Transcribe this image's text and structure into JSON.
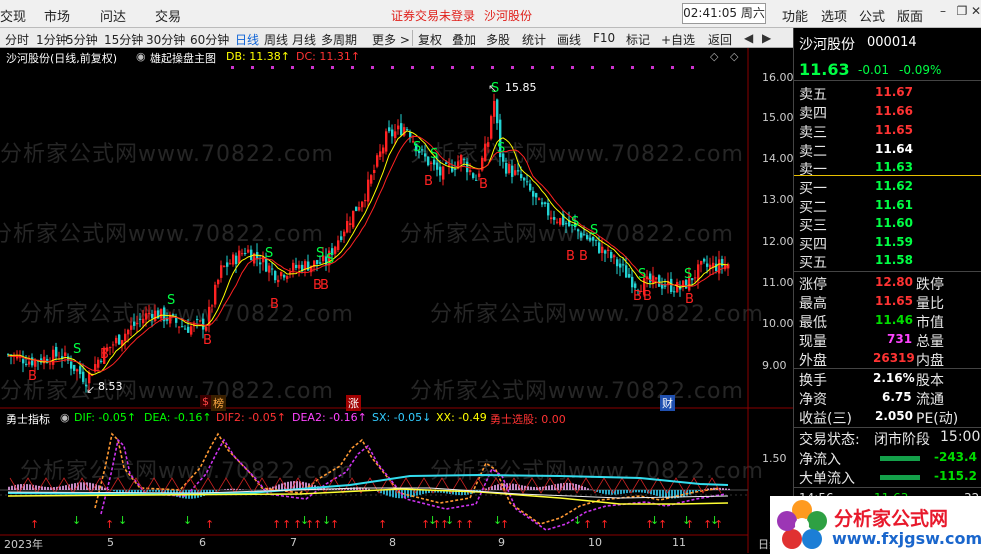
{
  "menubar": {
    "items": [
      "交现",
      "市场",
      "问达",
      "交易"
    ],
    "warning": "证券交易未登录",
    "stock_name": "沙河股份",
    "clock": "02:41:05 周六",
    "right": [
      "功能",
      "选项",
      "公式",
      "版面"
    ]
  },
  "toolbar": {
    "periods": [
      "分时",
      "1分钟",
      "5分钟",
      "15分钟",
      "30分钟",
      "60分钟",
      "日线",
      "周线",
      "月线",
      "多周期",
      "更多 >"
    ],
    "active": "日线",
    "tools": [
      "复权",
      "叠加",
      "多股",
      "统计",
      "画线",
      "F10",
      "标记",
      "+自选",
      "返回"
    ]
  },
  "main_chart": {
    "title": "沙河股份(日线,前复权)",
    "indicator": "雄起操盘主图",
    "db": "DB: 11.38↑",
    "dc": "DC: 11.31↑",
    "hi_label": "15.85",
    "lo_label": "8.53",
    "y_labels": [
      "16.00",
      "15.00",
      "14.00",
      "13.00",
      "12.00",
      "11.00",
      "10.00",
      "9.00"
    ],
    "event_marks": [
      "$",
      "榜",
      "涨",
      "财"
    ]
  },
  "sub_chart": {
    "name": "勇士指标",
    "items": [
      {
        "t": "DIF: -0.05↑",
        "c": "#00ff00"
      },
      {
        "t": "DEA: -0.16↑",
        "c": "#00ff00"
      },
      {
        "t": "DIF2: -0.05↑",
        "c": "#ff3333"
      },
      {
        "t": "DEA2: -0.16↑",
        "c": "#ff44ff"
      },
      {
        "t": "SX: -0.05↓",
        "c": "#33ccff"
      },
      {
        "t": "XX: -0.49",
        "c": "#ffff00"
      },
      {
        "t": "勇士选股: 0.00",
        "c": "#ff3333"
      }
    ],
    "y_label": "1.50"
  },
  "x_axis": [
    "2023年",
    "5",
    "6",
    "7",
    "8",
    "9",
    "10",
    "11",
    "日线"
  ],
  "watermark": "分析家公式网www.70822.com",
  "quote": {
    "name": "沙河股份",
    "code": "000014",
    "price": "11.63",
    "change": "-0.01",
    "pct": "-0.09%",
    "asks": [
      {
        "l": "卖五",
        "p": "11.67"
      },
      {
        "l": "卖四",
        "p": "11.66"
      },
      {
        "l": "卖三",
        "p": "11.65"
      },
      {
        "l": "卖二",
        "p": "11.64"
      },
      {
        "l": "卖一",
        "p": "11.63"
      }
    ],
    "bids": [
      {
        "l": "买一",
        "p": "11.62"
      },
      {
        "l": "买二",
        "p": "11.61"
      },
      {
        "l": "买三",
        "p": "11.60"
      },
      {
        "l": "买四",
        "p": "11.59"
      },
      {
        "l": "买五",
        "p": "11.58"
      }
    ],
    "stats": [
      {
        "l": "涨停",
        "v": "12.80",
        "vc": "#ff3333",
        "r": "跌停"
      },
      {
        "l": "最高",
        "v": "11.65",
        "vc": "#ff3333",
        "r": "量比"
      },
      {
        "l": "最低",
        "v": "11.46",
        "vc": "#00dd00",
        "r": "市值"
      },
      {
        "l": "现量",
        "v": "731",
        "vc": "#ff44ff",
        "r": "总量"
      },
      {
        "l": "外盘",
        "v": "26319",
        "vc": "#ff3333",
        "r": "内盘"
      },
      {
        "l": "换手",
        "v": "2.16%",
        "vc": "#ffffff",
        "r": "股本"
      },
      {
        "l": "净资",
        "v": "6.75",
        "vc": "#ffffff",
        "r": "流通"
      },
      {
        "l": "收益(三)",
        "v": "2.050",
        "vc": "#ffffff",
        "r": "PE(动)"
      }
    ],
    "status_label": "交易状态:",
    "status_value": "闭市阶段",
    "status_time": "15:00",
    "flows": [
      {
        "l": "净流入",
        "v": "-243.4"
      },
      {
        "l": "大单流入",
        "v": "-115.2"
      }
    ],
    "last_tick": [
      "14:56",
      "11.63",
      "32"
    ]
  },
  "logo": {
    "cn": "分析家公式网",
    "url": "www.fxjgsw.com"
  },
  "colors": {
    "up": "#ff2222",
    "down": "#22d3d3",
    "ma1": "#ffff00",
    "ma2": "#ff2222",
    "accent": "#1064d6"
  }
}
